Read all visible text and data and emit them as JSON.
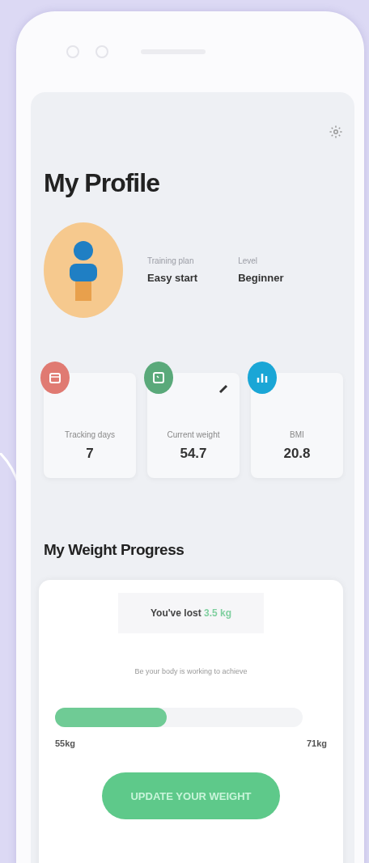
{
  "title": "My Profile",
  "profile": {
    "plan_label": "Training plan",
    "plan": "Easy start",
    "level_label": "Level",
    "level": "Beginner"
  },
  "stats": [
    {
      "kind": "days",
      "label": "Tracking days",
      "value": "7",
      "color": "#e07a72",
      "editable": false
    },
    {
      "kind": "weight",
      "label": "Current weight",
      "value": "54.7",
      "color": "#5aa97a",
      "editable": true
    },
    {
      "kind": "bmi",
      "label": "BMI",
      "value": "20.8",
      "color": "#1aa6d6",
      "editable": false
    }
  ],
  "progress": {
    "heading": "My Weight Progress",
    "lost": "You've lost **3.5 kg**",
    "note": "Be your body is working to achieve",
    "level": 0.45,
    "start": "55kg",
    "goal": "71kg",
    "button": "UPDATE YOUR WEIGHT"
  }
}
